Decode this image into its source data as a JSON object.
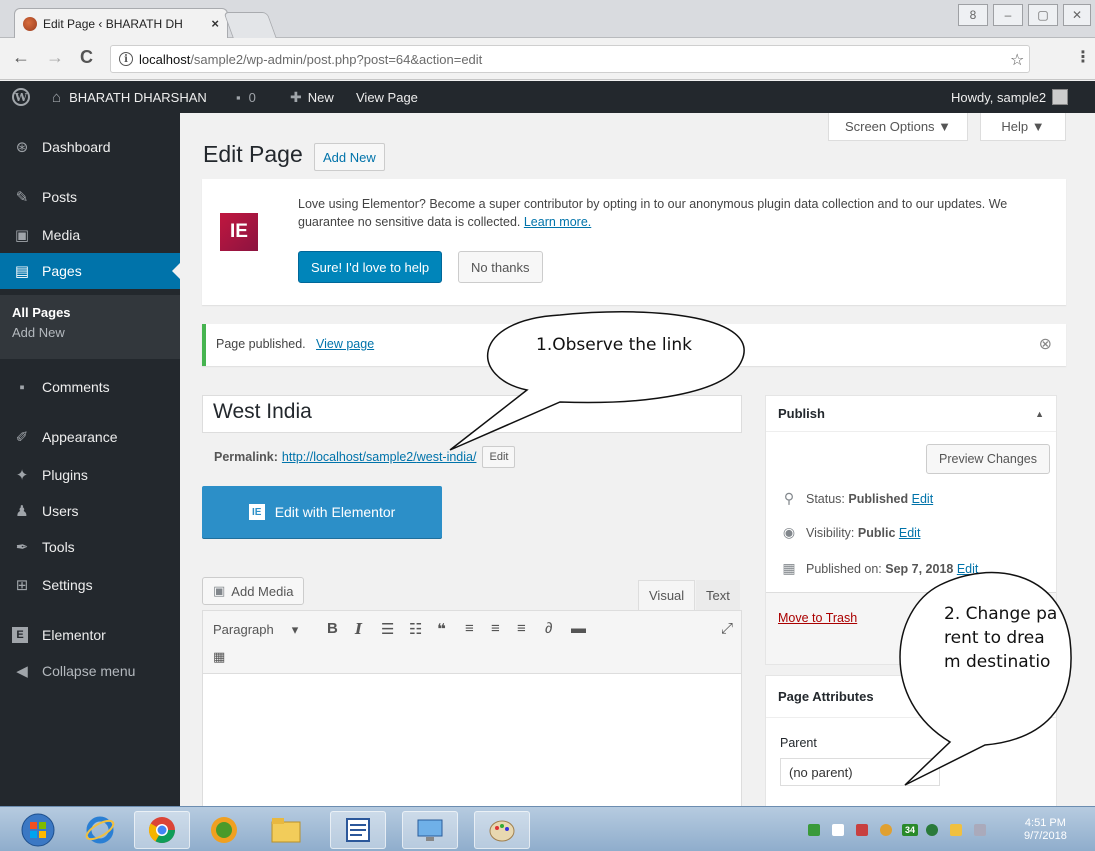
{
  "browser": {
    "tab_title": "Edit Page ‹ BHARATH DH",
    "tab_close": "×",
    "url_host": "localhost",
    "url_path": "/sample2/wp-admin/post.php?post=64&action=edit",
    "back": "←",
    "forward": "→",
    "reload": "C",
    "info": "i",
    "star": "☆",
    "menu": "⋮",
    "win_user": "8",
    "win_min": "–",
    "win_max": "▢",
    "win_close": "✕"
  },
  "adminbar": {
    "wp_logo": "W",
    "site_icon": "⌂",
    "site_name": "BHARATH DHARSHAN",
    "comments_icon": "▪",
    "comments_count": "0",
    "new_icon": "✚",
    "new_label": "New",
    "view_page": "View Page",
    "howdy": "Howdy, sample2"
  },
  "sidebar": {
    "items": [
      {
        "label": "Dashboard",
        "icon": "⊛"
      },
      {
        "label": "Posts",
        "icon": "✎"
      },
      {
        "label": "Media",
        "icon": "▣"
      },
      {
        "label": "Pages",
        "icon": "▤"
      },
      {
        "label": "Comments",
        "icon": "▪"
      },
      {
        "label": "Appearance",
        "icon": "✐"
      },
      {
        "label": "Plugins",
        "icon": "✦"
      },
      {
        "label": "Users",
        "icon": "♟"
      },
      {
        "label": "Tools",
        "icon": "✒"
      },
      {
        "label": "Settings",
        "icon": "⊞"
      },
      {
        "label": "Elementor",
        "icon": "E"
      },
      {
        "label": "Collapse menu",
        "icon": "◀"
      }
    ],
    "submenu": {
      "all_pages": "All Pages",
      "add_new": "Add New"
    }
  },
  "main": {
    "screen_options": "Screen Options ▼",
    "help": "Help ▼",
    "page_title": "Edit Page",
    "add_new": "Add New",
    "elementor_notice": {
      "logo": "IE",
      "text": "Love using Elementor? Become a super contributor by opting in to our anonymous plugin data collection and to our updates. We guarantee no sensitive data is collected.",
      "learn_more": "Learn more.",
      "accept": "Sure! I'd love to help",
      "decline": "No thanks"
    },
    "published_notice": {
      "text": "Page published.",
      "link": "View page",
      "dismiss": "⊗"
    },
    "title_value": "West India",
    "permalink_label": "Permalink:",
    "permalink_base": "http://localhost/sample2/",
    "permalink_slug": "west-india",
    "permalink_trail": "/",
    "permalink_edit": "Edit",
    "edit_with_elementor": "Edit with Elementor",
    "elementor_icon": "IE",
    "add_media_icon": "▣",
    "add_media": "Add Media",
    "tab_visual": "Visual",
    "tab_text": "Text",
    "format_select": "Paragraph",
    "format_caret": "▾",
    "toolbar": {
      "bold": "B",
      "italic": "I",
      "bullets": "☰",
      "numbers": "☷",
      "quote": "❝",
      "align_left": "≡",
      "align_center": "≡",
      "align_right": "≡",
      "link": "∂",
      "more": "▬",
      "fullscreen": "⤢",
      "kitchen_sink": "▦"
    }
  },
  "publish": {
    "title": "Publish",
    "toggle": "▲",
    "preview": "Preview Changes",
    "status_icon": "⚲",
    "status_label": "Status:",
    "status_value": "Published",
    "status_edit": "Edit",
    "visibility_icon": "◉",
    "visibility_label": "Visibility:",
    "visibility_value": "Public",
    "visibility_edit": "Edit",
    "date_icon": "▦",
    "published_on_label": "Published on:",
    "published_on_value": "Sep 7, 2018",
    "published_on_edit": "Edit",
    "trash": "Move to Trash"
  },
  "page_attributes": {
    "title": "Page Attributes",
    "parent_label": "Parent",
    "parent_value": "(no parent)"
  },
  "callouts": {
    "c1": "1.Observe the link",
    "c2": "2. Change parent to dream destinatio"
  },
  "taskbar": {
    "tray_number": "34",
    "time": "4:51 PM",
    "date": "9/7/2018"
  }
}
